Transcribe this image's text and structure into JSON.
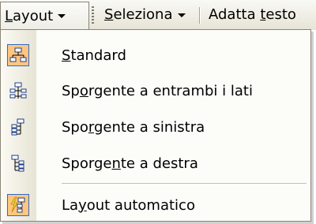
{
  "toolbar": {
    "layout": {
      "pre": "",
      "key": "L",
      "post": "ayout"
    },
    "seleziona": {
      "pre": "",
      "key": "S",
      "post": "eleziona"
    },
    "adatta": {
      "pre": "Adatta ",
      "key": "t",
      "post": "esto"
    }
  },
  "menu": {
    "items": [
      {
        "pre": "",
        "key": "S",
        "post": "tandard",
        "icon": "org-chart-standard-icon",
        "checked": true
      },
      {
        "pre": "Sp",
        "key": "o",
        "post": "rgente a entrambi i lati",
        "icon": "org-chart-both-hanging-icon",
        "checked": false
      },
      {
        "pre": "Spo",
        "key": "r",
        "post": "gente a sinistra",
        "icon": "org-chart-left-hanging-icon",
        "checked": false
      },
      {
        "pre": "Sporge",
        "key": "n",
        "post": "te a destra",
        "icon": "org-chart-right-hanging-icon",
        "checked": false
      },
      {
        "pre": "La",
        "key": "y",
        "post": "out automatico",
        "icon": "autolayout-icon",
        "checked": true
      }
    ]
  },
  "colors": {
    "checked_bg": "#ffc680",
    "checked_border": "#316ac5",
    "toolbar": "#ece9d8"
  }
}
